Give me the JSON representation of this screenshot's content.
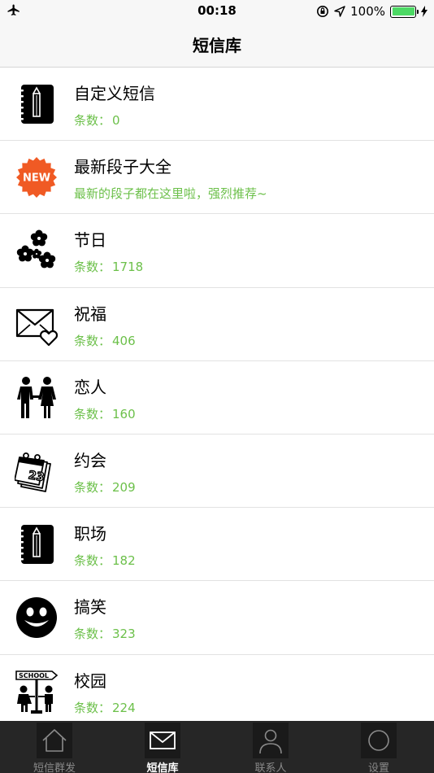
{
  "status_bar": {
    "time": "00:18",
    "battery_text": "100%",
    "battery_level": 1.0,
    "icons": [
      "airplane-icon",
      "orientation-lock-icon",
      "location-arrow-icon",
      "battery-icon",
      "charging-bolt-icon"
    ]
  },
  "nav": {
    "title": "短信库"
  },
  "list": [
    {
      "icon": "notebook-icon",
      "title": "自定义短信",
      "prefix": "条数：",
      "count": "0"
    },
    {
      "icon": "new-badge-icon",
      "title": "最新段子大全",
      "prefix": "最新的段子都在这里啦，强烈推荐~",
      "count": ""
    },
    {
      "icon": "flowers-icon",
      "title": "节日",
      "prefix": "条数：",
      "count": "1718"
    },
    {
      "icon": "envelope-heart-icon",
      "title": "祝福",
      "prefix": "条数：",
      "count": "406"
    },
    {
      "icon": "couple-icon",
      "title": "恋人",
      "prefix": "条数：",
      "count": "160"
    },
    {
      "icon": "calendar-icon",
      "title": "约会",
      "prefix": "条数：",
      "count": "209"
    },
    {
      "icon": "notebook-icon",
      "title": "职场",
      "prefix": "条数：",
      "count": "182"
    },
    {
      "icon": "smiley-icon",
      "title": "搞笑",
      "prefix": "条数：",
      "count": "323"
    },
    {
      "icon": "school-sign-icon",
      "title": "校园",
      "prefix": "条数：",
      "count": "224",
      "sign_text": "SCHOOL"
    }
  ],
  "tabs": [
    {
      "icon": "home-icon",
      "label": "短信群发"
    },
    {
      "icon": "envelope-icon",
      "label": "短信库",
      "active": true
    },
    {
      "icon": "person-icon",
      "label": "联系人"
    },
    {
      "icon": "circle-icon",
      "label": "设置"
    }
  ],
  "colors": {
    "accent_green": "#6cc04a",
    "new_badge": "#f05a24",
    "tab_bar": "#262626"
  },
  "icons": {
    "new_badge_text": "NEW",
    "calendar_number": "23"
  }
}
